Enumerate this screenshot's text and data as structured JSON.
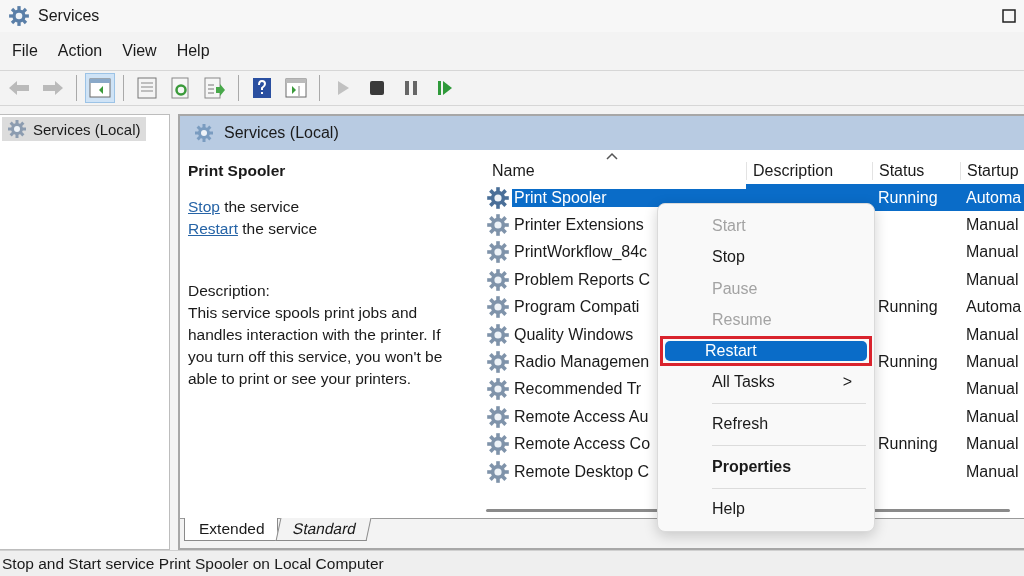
{
  "window": {
    "title": "Services"
  },
  "menu": [
    "File",
    "Action",
    "View",
    "Help"
  ],
  "toolbar": [
    {
      "kind": "back",
      "pressed": false,
      "disabled": true
    },
    {
      "kind": "forward",
      "pressed": false,
      "disabled": true
    },
    {
      "kind": "sep"
    },
    {
      "kind": "tree",
      "pressed": true,
      "disabled": false
    },
    {
      "kind": "sep"
    },
    {
      "kind": "properties",
      "pressed": false,
      "disabled": false
    },
    {
      "kind": "refresh",
      "pressed": false,
      "disabled": false
    },
    {
      "kind": "export",
      "pressed": false,
      "disabled": false
    },
    {
      "kind": "sep"
    },
    {
      "kind": "help",
      "pressed": false,
      "disabled": false
    },
    {
      "kind": "pane",
      "pressed": false,
      "disabled": false
    },
    {
      "kind": "sep"
    },
    {
      "kind": "play",
      "pressed": false,
      "disabled": true
    },
    {
      "kind": "stop",
      "pressed": false,
      "disabled": false
    },
    {
      "kind": "pause",
      "pressed": false,
      "disabled": false
    },
    {
      "kind": "resume",
      "pressed": false,
      "disabled": false
    }
  ],
  "tree": {
    "items": [
      {
        "label": "Services (Local)",
        "selected": true
      }
    ]
  },
  "panel": {
    "title": "Services (Local)",
    "service_name": "Print Spooler",
    "actions": [
      {
        "link": "Stop",
        "text": " the service"
      },
      {
        "link": "Restart",
        "text": " the service"
      }
    ],
    "description_label": "Description:",
    "description": "This service spools print jobs and handles interaction with the printer. If you turn off this service, you won't be able to print or see your printers."
  },
  "table": {
    "columns": [
      "Name",
      "Description",
      "Status",
      "Startup"
    ],
    "rows": [
      {
        "name": "Print Spooler",
        "status": "Running",
        "startup": "Automa",
        "selected": true
      },
      {
        "name": "Printer Extensions",
        "startup": "Manual",
        "selected": false
      },
      {
        "name": "PrintWorkflow_84c",
        "startup": "Manual",
        "selected": false
      },
      {
        "name": "Problem Reports C",
        "startup": "Manual",
        "selected": false
      },
      {
        "name": "Program Compati",
        "status": "Running",
        "startup": "Automa",
        "selected": false
      },
      {
        "name": "Quality Windows",
        "startup": "Manual",
        "selected": false
      },
      {
        "name": "Radio Managemen",
        "status": "Running",
        "startup": "Manual",
        "selected": false
      },
      {
        "name": "Recommended Tr",
        "startup": "Manual",
        "selected": false
      },
      {
        "name": "Remote Access Au",
        "startup": "Manual",
        "selected": false
      },
      {
        "name": "Remote Access Co",
        "status": "Running",
        "startup": "Manual",
        "selected": false
      },
      {
        "name": "Remote Desktop C",
        "startup": "Manual",
        "selected": false
      }
    ]
  },
  "context_menu": [
    {
      "kind": "item",
      "label": "Start",
      "disabled": true,
      "selected": false,
      "bold": false
    },
    {
      "kind": "item",
      "label": "Stop",
      "disabled": false,
      "selected": false,
      "bold": false
    },
    {
      "kind": "item",
      "label": "Pause",
      "disabled": true,
      "selected": false,
      "bold": false
    },
    {
      "kind": "item",
      "label": "Resume",
      "disabled": true,
      "selected": false,
      "bold": false
    },
    {
      "kind": "item",
      "label": "Restart",
      "disabled": false,
      "selected": true,
      "bold": false
    },
    {
      "kind": "submenu",
      "label": "All Tasks",
      "arrow": ">",
      "disabled": false,
      "selected": false,
      "bold": false
    },
    {
      "kind": "sep"
    },
    {
      "kind": "item",
      "label": "Refresh",
      "disabled": false,
      "selected": false,
      "bold": false
    },
    {
      "kind": "sep"
    },
    {
      "kind": "item",
      "label": "Properties",
      "disabled": false,
      "selected": false,
      "bold": true
    },
    {
      "kind": "sep"
    },
    {
      "kind": "item",
      "label": "Help",
      "disabled": false,
      "selected": false,
      "bold": false
    }
  ],
  "view_tabs": [
    {
      "label": "Extended",
      "selected": true
    },
    {
      "label": "Standard",
      "selected": false
    }
  ],
  "status_bar": "Stop and Start service Print Spooler on Local Computer"
}
